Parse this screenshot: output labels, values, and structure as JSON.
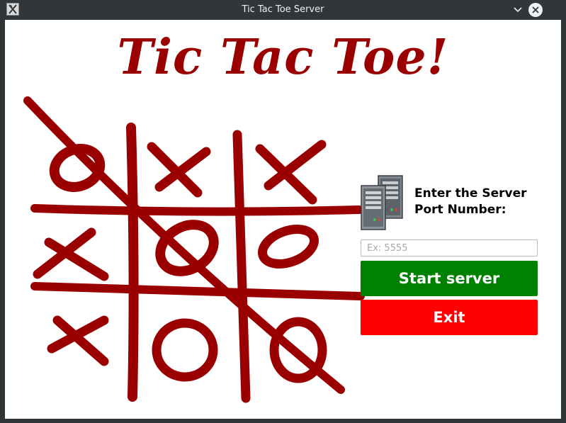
{
  "window": {
    "title": "Tic Tac Toe Server",
    "controls": [
      "chevron-down-icon",
      "close-icon"
    ]
  },
  "main": {
    "headline": "Tic Tac Toe!",
    "board_illustration": {
      "cells": [
        [
          "O",
          "X",
          "X"
        ],
        [
          "X",
          "O",
          "O"
        ],
        [
          "X",
          "O",
          "O"
        ]
      ],
      "winning_line": "diagonal top-left to bottom-right",
      "color": "#9b0000"
    }
  },
  "server": {
    "icon": "server-icon",
    "prompt": "Enter the Server Port Number:",
    "port_placeholder": "Ex: 5555",
    "port_value": ""
  },
  "buttons": {
    "start_label": "Start server",
    "start_color": "#008000",
    "exit_label": "Exit",
    "exit_color": "#ff0000"
  }
}
